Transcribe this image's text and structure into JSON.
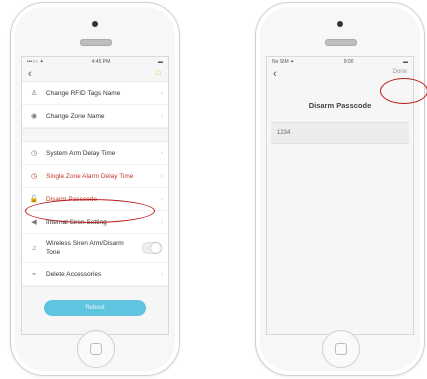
{
  "left_phone": {
    "status": {
      "left": "•••○○ ✦",
      "center": "4:45 PM",
      "right": "▬"
    },
    "menu": {
      "group1": [
        {
          "icon": "rfid-tag-icon",
          "glyph": "♙",
          "label": "Change RFID Tags Name"
        },
        {
          "icon": "zone-icon",
          "glyph": "◉",
          "label": "Change Zone Name"
        }
      ],
      "group2": [
        {
          "icon": "arm-delay-icon",
          "glyph": "◷",
          "label": "System Arm Delay Time"
        },
        {
          "icon": "zone-delay-icon",
          "glyph": "◷",
          "label": "Single Zone Alarm Delay Time"
        },
        {
          "icon": "lock-icon",
          "glyph": "🔓",
          "label": "Disarm Passcode"
        },
        {
          "icon": "speaker-icon",
          "glyph": "◀",
          "label": "Internal Siren Setting"
        },
        {
          "icon": "wireless-siren-icon",
          "glyph": "♫",
          "label": "Wireless Siren Arm/Disarm Tone"
        },
        {
          "icon": "delete-icon",
          "glyph": "⌁",
          "label": "Delete Accessories"
        }
      ]
    },
    "button_label": "Reboot"
  },
  "right_phone": {
    "status": {
      "left": "No SIM ✦",
      "center": "9:00",
      "right": "▬"
    },
    "nav_action": "Done",
    "title": "Disarm Passcode",
    "passcode_value": "1234"
  },
  "colors": {
    "accent": "#5ec4df",
    "highlight": "#b71c1c",
    "alert_text": "#c0392b"
  }
}
